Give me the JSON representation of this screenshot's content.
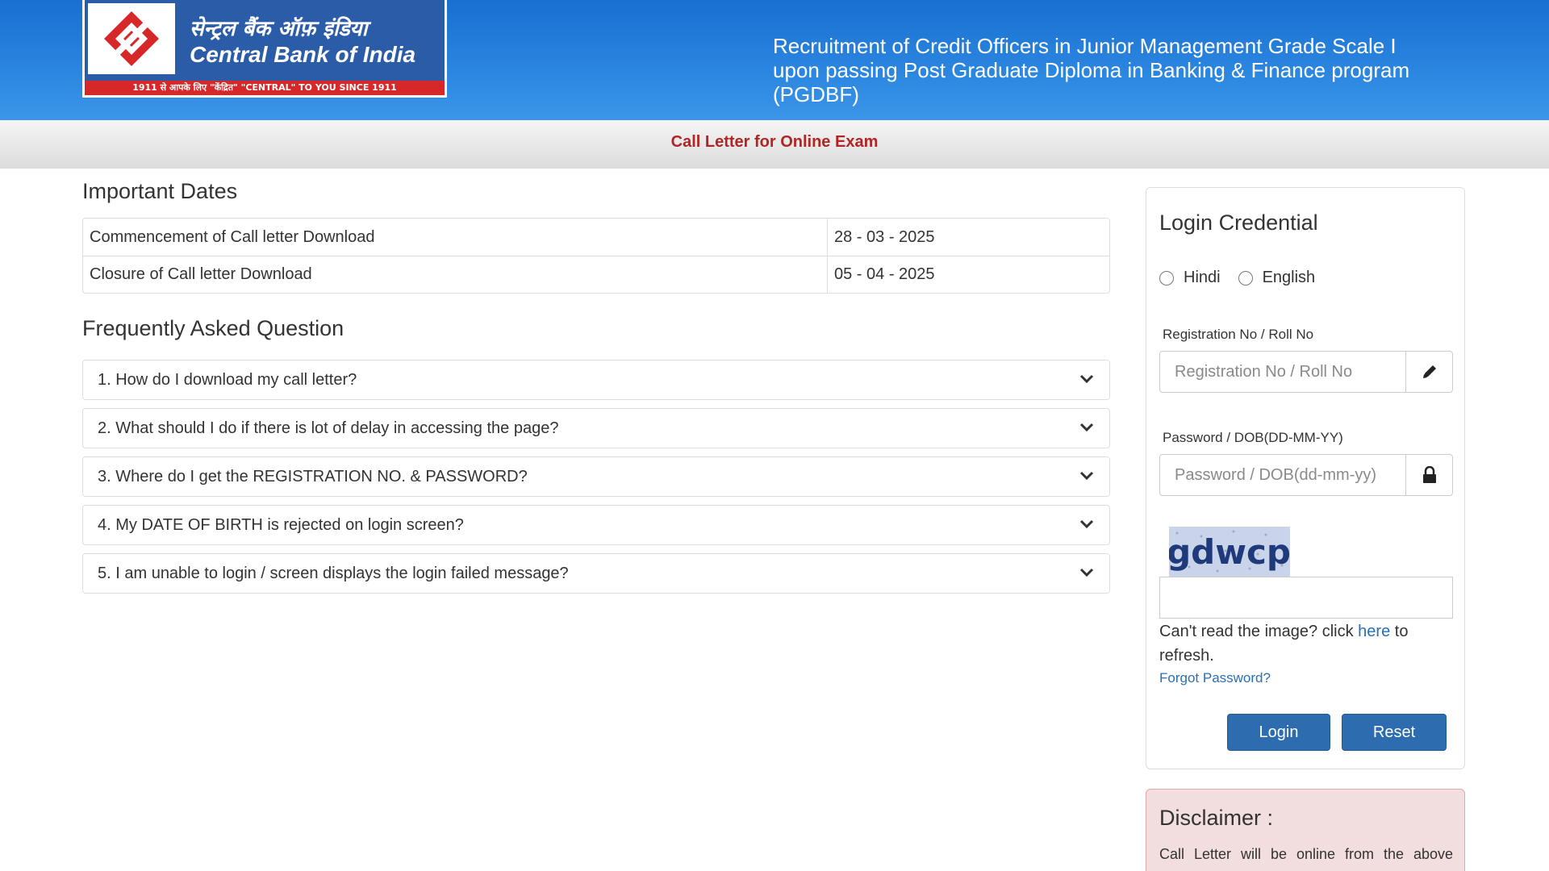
{
  "header": {
    "logo": {
      "hindi_name": "सेन्ट्रल बैंक ऑफ़ इंडिया",
      "english_name": "Central Bank of India",
      "tagline": "1911 से आपके लिए \"केंद्रित\"  \"CENTRAL\" TO YOU SINCE 1911"
    },
    "title": "Recruitment of Credit Officers in Junior Management Grade Scale I upon passing Post Graduate Diploma in Banking & Finance program (PGDBF)"
  },
  "subheader": {
    "title": "Call Letter for Online Exam"
  },
  "important_dates": {
    "heading": "Important Dates",
    "rows": [
      {
        "label": "Commencement of Call letter Download",
        "date": "28 - 03 - 2025"
      },
      {
        "label": "Closure of Call letter Download",
        "date": "05 - 04 - 2025"
      }
    ]
  },
  "faq": {
    "heading": "Frequently Asked Question",
    "items": [
      {
        "question": "1. How do I download my call letter?"
      },
      {
        "question": "2. What should I do if there is lot of delay in accessing the page?"
      },
      {
        "question": "3. Where do I get the REGISTRATION NO. & PASSWORD?"
      },
      {
        "question": "4. My DATE OF BIRTH is rejected on login screen?"
      },
      {
        "question": "5. I am unable to login / screen displays the login failed message?"
      }
    ]
  },
  "login": {
    "title": "Login Credential",
    "languages": [
      {
        "label": "Hindi"
      },
      {
        "label": "English"
      }
    ],
    "registration": {
      "label": "Registration No / Roll No",
      "placeholder": "Registration No / Roll No",
      "value": ""
    },
    "password": {
      "label": "Password / DOB(DD-MM-YY)",
      "placeholder": "Password / DOB(dd-mm-yy)",
      "value": ""
    },
    "captcha": {
      "text": "gdwcp",
      "input_value": ""
    },
    "refresh": {
      "prefix": "Can't read the image? click ",
      "link": "here",
      "suffix": " to refresh."
    },
    "forgot_password": "Forgot Password?",
    "buttons": {
      "login": "Login",
      "reset": "Reset"
    }
  },
  "disclaimer": {
    "title": "Disclaimer :",
    "text": "Call Letter will be online from the above"
  },
  "colors": {
    "header_blue": "#2b86e0",
    "subheader_red": "#b32424",
    "button_blue": "#2d6cae",
    "link_blue": "#2a6fb8",
    "disclaimer_bg": "#f2dede",
    "logo_red": "#d62828"
  },
  "icons": {
    "faq_toggle": "chevron-down-icon",
    "registration_addon": "pencil-icon",
    "password_addon": "lock-icon",
    "logo_mark": "bank-emblem-icon"
  }
}
